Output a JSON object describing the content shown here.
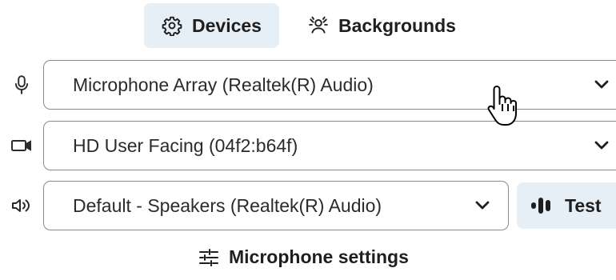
{
  "tabs": [
    {
      "label": "Devices",
      "icon": "gear-icon",
      "active": true
    },
    {
      "label": "Backgrounds",
      "icon": "background-person-icon",
      "active": false
    }
  ],
  "microphone": {
    "icon": "microphone-icon",
    "value": "Microphone Array (Realtek(R) Audio)"
  },
  "camera": {
    "icon": "camera-icon",
    "value": "HD User Facing (04f2:b64f)"
  },
  "speaker": {
    "icon": "speaker-icon",
    "value": "Default - Speakers (Realtek(R) Audio)"
  },
  "test_button": {
    "label": "Test",
    "icon": "audio-bars-icon"
  },
  "mic_settings": {
    "label": "Microphone settings",
    "icon": "sliders-icon"
  },
  "colors": {
    "active_tab_bg": "#e6eef6",
    "border": "#8a8a8a",
    "text": "#1f1f1f"
  }
}
